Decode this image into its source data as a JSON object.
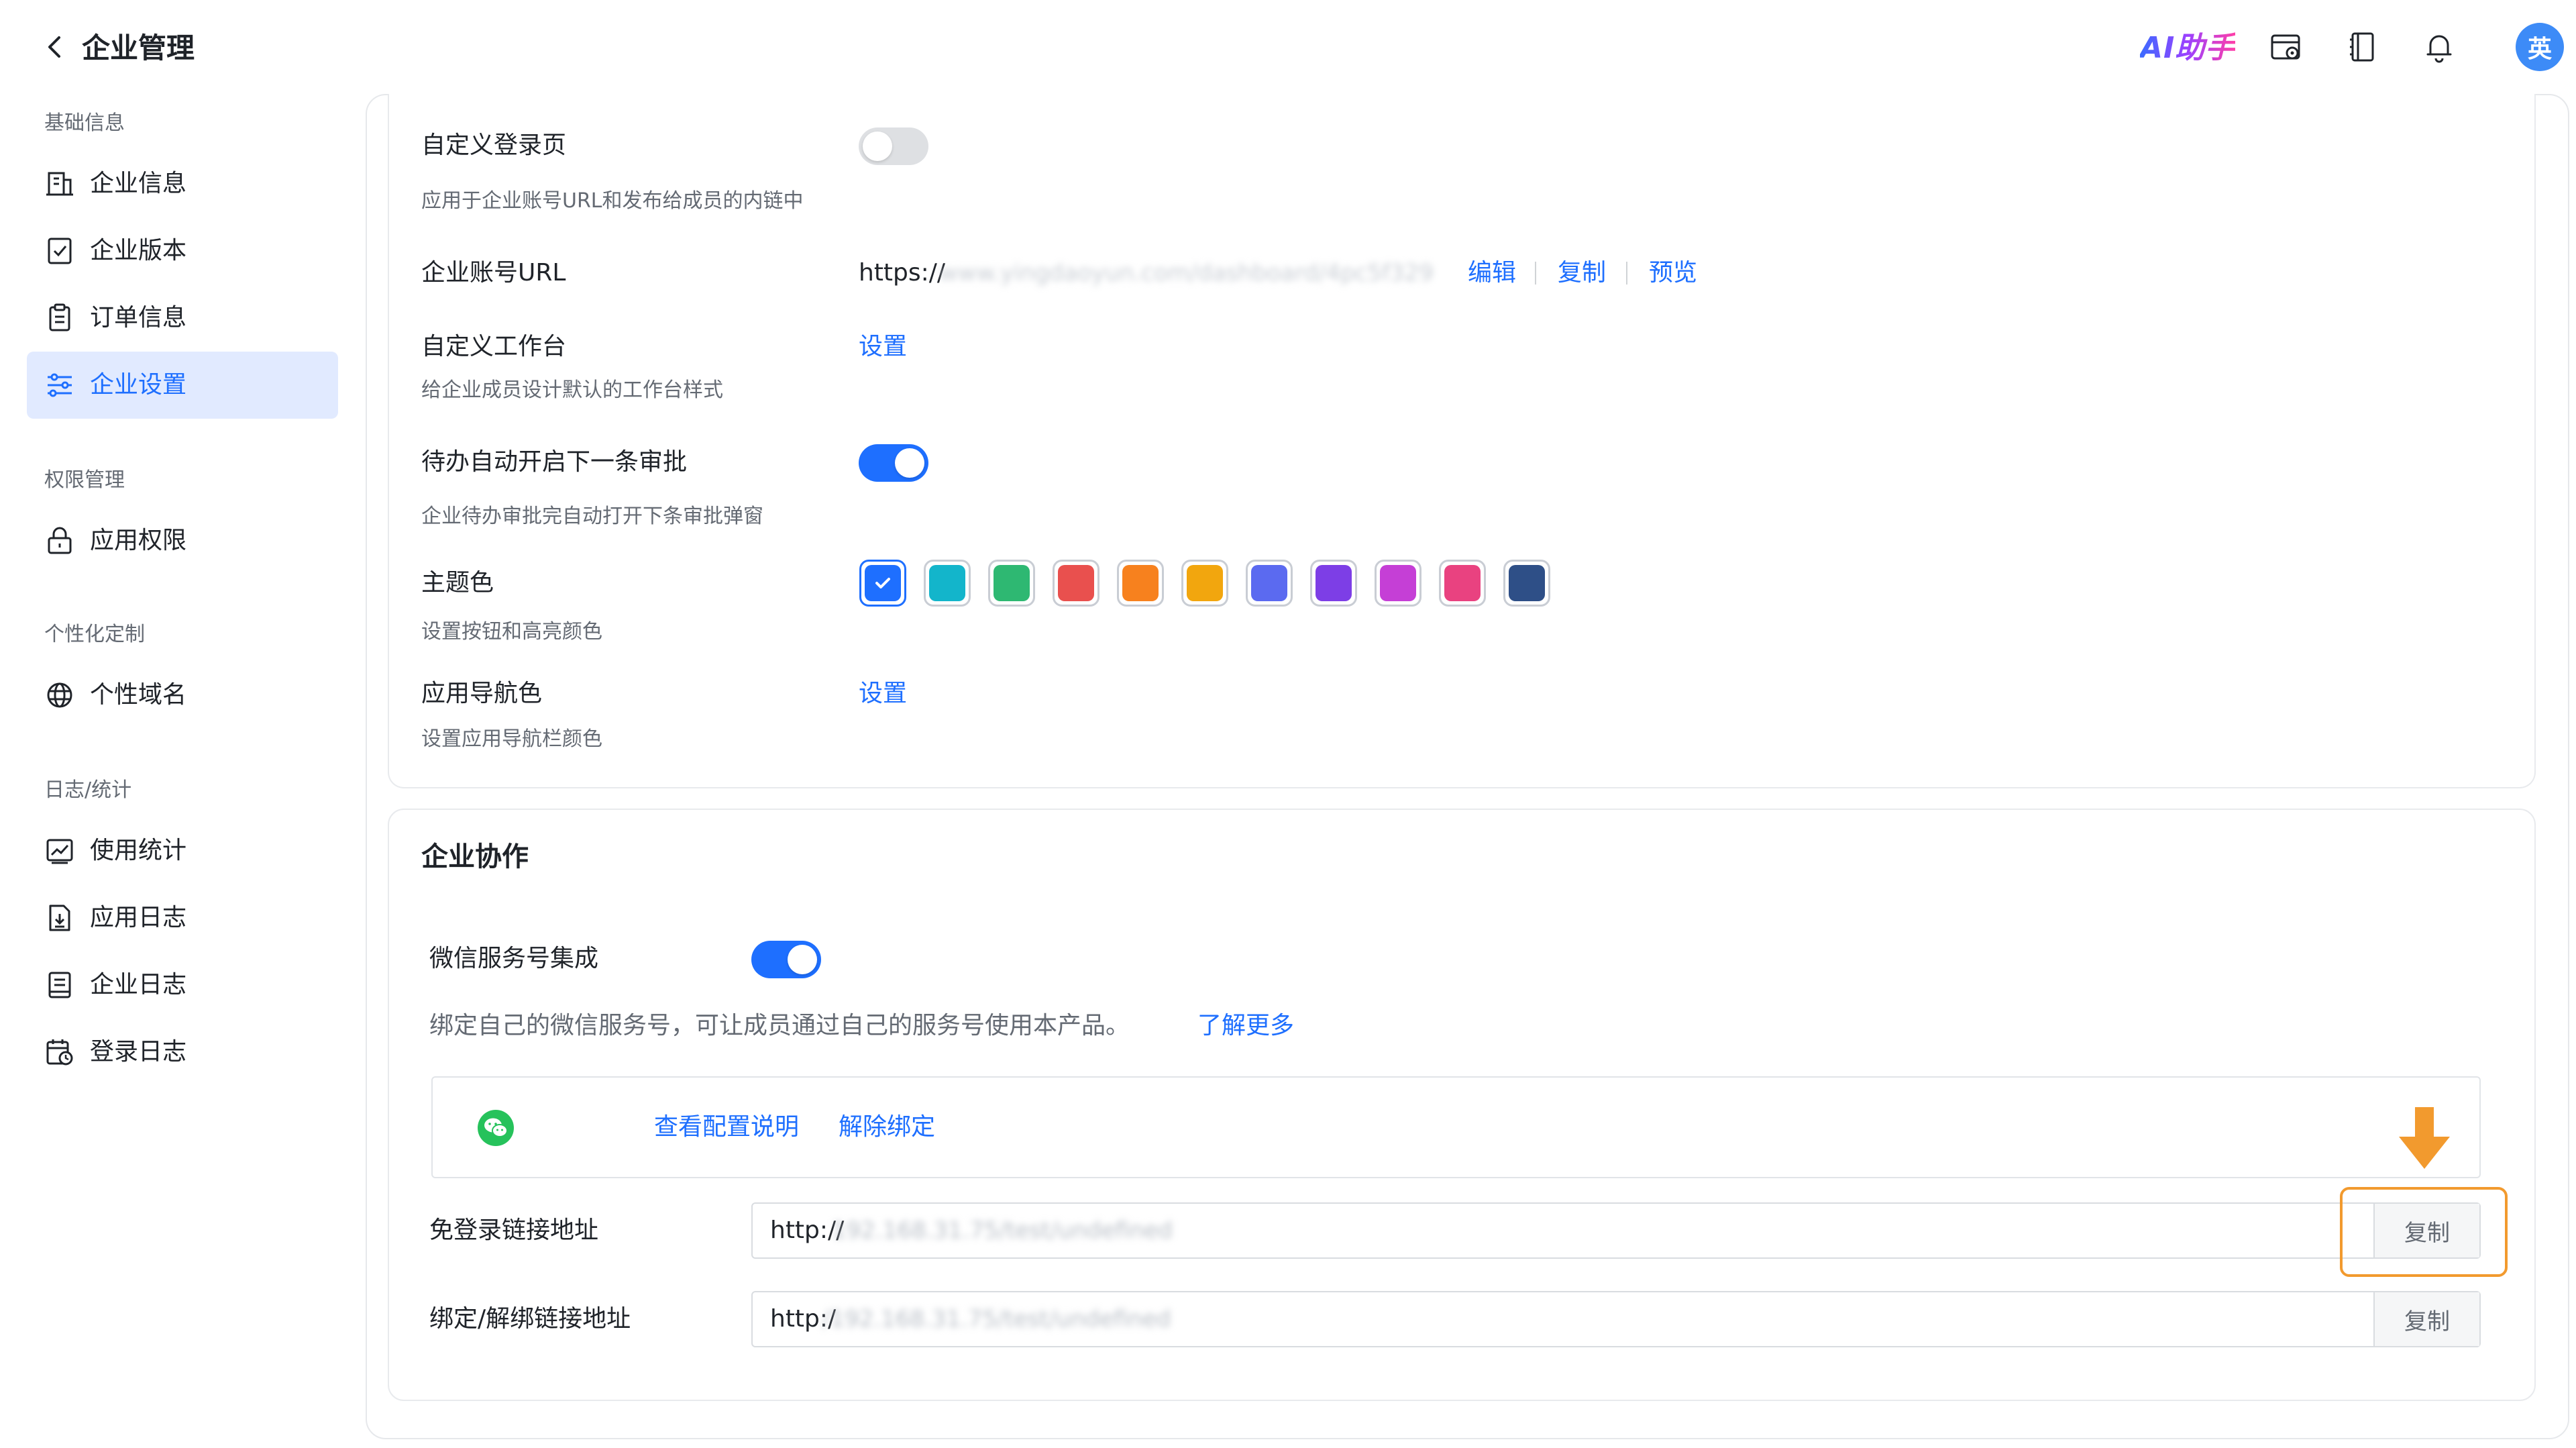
{
  "header": {
    "title": "企业管理",
    "ai_label": "AI助手",
    "icons": [
      "calendar-settings-icon",
      "book-icon",
      "bell-icon"
    ],
    "avatar_text": "英"
  },
  "sidebar": {
    "groups": [
      {
        "title": "基础信息",
        "items": [
          {
            "label": "企业信息",
            "icon": "building-icon"
          },
          {
            "label": "企业版本",
            "icon": "version-icon"
          },
          {
            "label": "订单信息",
            "icon": "order-icon"
          },
          {
            "label": "企业设置",
            "icon": "settings-sliders-icon",
            "active": true
          }
        ]
      },
      {
        "title": "权限管理",
        "items": [
          {
            "label": "应用权限",
            "icon": "lock-icon"
          }
        ]
      },
      {
        "title": "个性化定制",
        "items": [
          {
            "label": "个性域名",
            "icon": "globe-icon"
          }
        ]
      },
      {
        "title": "日志/统计",
        "items": [
          {
            "label": "使用统计",
            "icon": "chart-icon"
          },
          {
            "label": "应用日志",
            "icon": "app-log-icon"
          },
          {
            "label": "企业日志",
            "icon": "enterprise-log-icon"
          },
          {
            "label": "登录日志",
            "icon": "login-log-icon"
          }
        ]
      }
    ]
  },
  "settings": {
    "custom_login": {
      "label": "自定义登录页",
      "desc": "应用于企业账号URL和发布给成员的内链中",
      "enabled": false
    },
    "account_url": {
      "label": "企业账号URL",
      "prefix": "https://",
      "masked": "www.yingdaoyun.com/dashboard/4pc5f329",
      "edit": "编辑",
      "copy": "复制",
      "preview": "预览"
    },
    "custom_workbench": {
      "label": "自定义工作台",
      "desc": "给企业成员设计默认的工作台样式",
      "action": "设置"
    },
    "auto_next": {
      "label": "待办自动开启下一条审批",
      "desc": "企业待办审批完自动打开下条审批弹窗",
      "enabled": true
    },
    "theme": {
      "label": "主题色",
      "desc": "设置按钮和高亮颜色",
      "colors": [
        "#1e6fff",
        "#13b5cb",
        "#2eb872",
        "#e9504e",
        "#f7811e",
        "#f2a60e",
        "#5b6af0",
        "#7d3ee6",
        "#c53fd6",
        "#e94280",
        "#2e4f87"
      ],
      "selected_index": 0
    },
    "nav_color": {
      "label": "应用导航色",
      "desc": "设置应用导航栏颜色",
      "action": "设置"
    }
  },
  "collab": {
    "title": "企业协作",
    "wechat": {
      "label": "微信服务号集成",
      "enabled": true,
      "desc": "绑定自己的微信服务号，可让成员通过自己的服务号使用本产品。",
      "learn_more": "了解更多",
      "view_guide": "查看配置说明",
      "unbind": "解除绑定"
    },
    "login_free": {
      "label": "免登录链接地址",
      "prefix": "http://",
      "masked": "192.168.31.75/test/undefined",
      "copy": "复制"
    },
    "bind_link": {
      "label": "绑定/解绑链接地址",
      "prefix": "http:/",
      "masked": "/192.168.31.75/test/undefined",
      "copy": "复制"
    }
  },
  "annotation_color": "#f29a2e"
}
